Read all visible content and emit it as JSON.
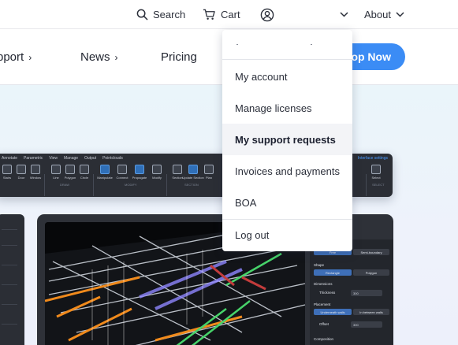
{
  "topbar": {
    "search_label": "Search",
    "cart_label": "Cart",
    "about_label": "About"
  },
  "nav": {
    "support_label": "pport",
    "news_label": "News",
    "pricing_label": "Pricing",
    "shop_label": "hop Now",
    "chevron": "›"
  },
  "account_menu": {
    "items": [
      {
        "label": "My account"
      },
      {
        "label": "Manage licenses"
      },
      {
        "label": "My support requests"
      },
      {
        "label": "Invoices and payments"
      },
      {
        "label": "BOA"
      },
      {
        "label": "Log out"
      }
    ]
  },
  "software_preview": {
    "menu_tabs": [
      "Annotate",
      "Parametric",
      "View",
      "Manage",
      "Output",
      "Pointclouds"
    ],
    "interface_label": "Interface settings",
    "tools": [
      "Stairs",
      "Door",
      "Window",
      "Line",
      "Polygon",
      "Circle",
      "Manipulate",
      "Connect",
      "Propagate",
      "Modify",
      "Section",
      "Update Section",
      "Plan",
      "Select"
    ],
    "groups": [
      "DRAW",
      "MODIFY",
      "SECTION",
      "SELECT"
    ],
    "panel": {
      "segment_a": [
        "Free",
        "Semi-boundary"
      ],
      "shape_label": "Shape",
      "shape_options": [
        "Rectangle",
        "Polygon"
      ],
      "dimensions_label": "Dimensions",
      "thickness_label": "Thickness",
      "thickness_value": "300",
      "placement_label": "Placement",
      "placement_options": [
        "Underneath walls",
        "In between walls"
      ],
      "offset_label": "Offset",
      "offset_value": "300",
      "composition_label": "Composition"
    }
  },
  "colors": {
    "accent": "#3b8cf5",
    "dark_ui": "#2b2e35",
    "hero_bg": "#eaf5fa",
    "active_item_bg": "#f3f4f7"
  }
}
